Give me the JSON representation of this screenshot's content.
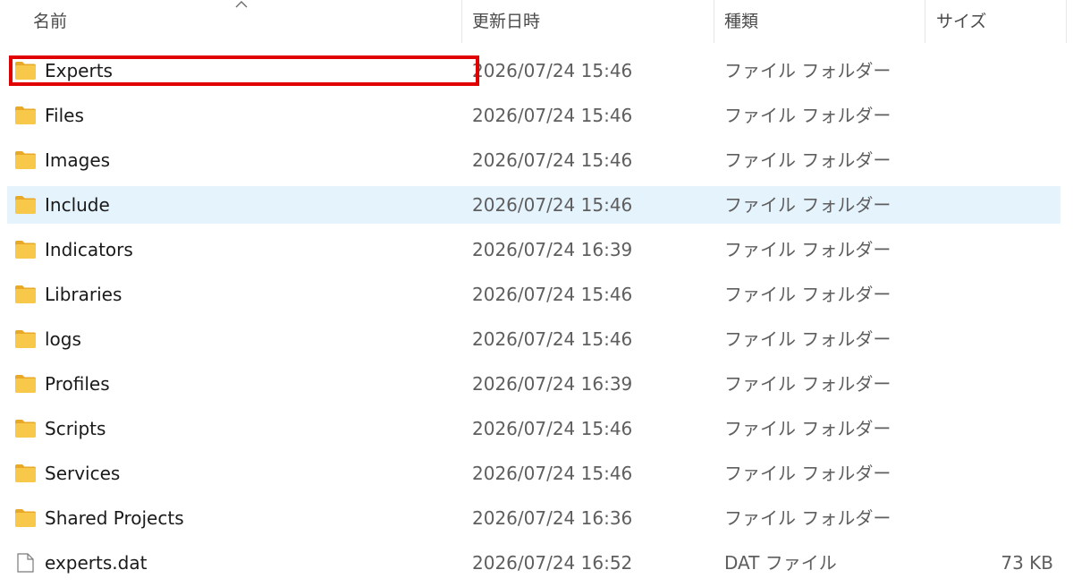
{
  "columns": {
    "name": "名前",
    "date": "更新日時",
    "type": "種類",
    "size": "サイズ"
  },
  "sort": {
    "column": "name",
    "direction": "ascending"
  },
  "colors": {
    "hover_row": "#e5f3fd",
    "highlight_outline": "#e00000",
    "folder_yellow": "#f8c84a"
  },
  "rows": [
    {
      "icon": "folder-icon",
      "name": "Experts",
      "date": "2026/07/24 15:46",
      "type": "ファイル フォルダー",
      "size": "",
      "highlighted": true
    },
    {
      "icon": "folder-icon",
      "name": "Files",
      "date": "2026/07/24 15:46",
      "type": "ファイル フォルダー",
      "size": ""
    },
    {
      "icon": "folder-icon",
      "name": "Images",
      "date": "2026/07/24 15:46",
      "type": "ファイル フォルダー",
      "size": ""
    },
    {
      "icon": "folder-icon",
      "name": "Include",
      "date": "2026/07/24 15:46",
      "type": "ファイル フォルダー",
      "size": "",
      "hovered": true
    },
    {
      "icon": "folder-icon",
      "name": "Indicators",
      "date": "2026/07/24 16:39",
      "type": "ファイル フォルダー",
      "size": ""
    },
    {
      "icon": "folder-icon",
      "name": "Libraries",
      "date": "2026/07/24 15:46",
      "type": "ファイル フォルダー",
      "size": ""
    },
    {
      "icon": "folder-icon",
      "name": "logs",
      "date": "2026/07/24 15:46",
      "type": "ファイル フォルダー",
      "size": ""
    },
    {
      "icon": "folder-icon",
      "name": "Profiles",
      "date": "2026/07/24 16:39",
      "type": "ファイル フォルダー",
      "size": ""
    },
    {
      "icon": "folder-icon",
      "name": "Scripts",
      "date": "2026/07/24 15:46",
      "type": "ファイル フォルダー",
      "size": ""
    },
    {
      "icon": "folder-icon",
      "name": "Services",
      "date": "2026/07/24 15:46",
      "type": "ファイル フォルダー",
      "size": ""
    },
    {
      "icon": "folder-icon",
      "name": "Shared Projects",
      "date": "2026/07/24 16:36",
      "type": "ファイル フォルダー",
      "size": ""
    },
    {
      "icon": "file-icon",
      "name": "experts.dat",
      "date": "2026/07/24 16:52",
      "type": "DAT ファイル",
      "size": "73 KB"
    }
  ]
}
